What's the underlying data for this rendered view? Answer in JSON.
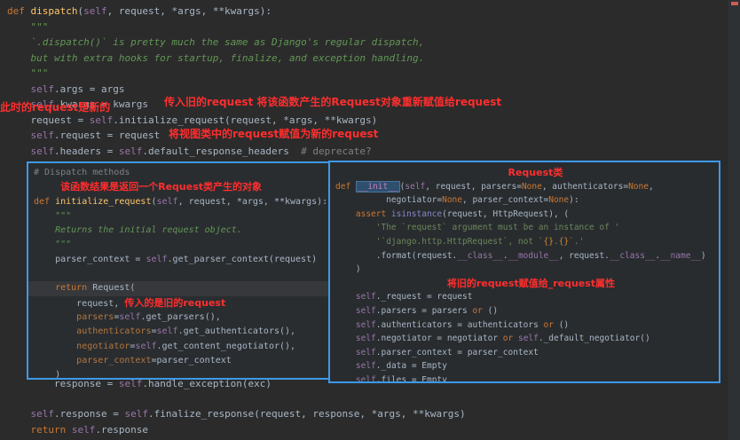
{
  "colors": {
    "bg": "#2b2b2b",
    "fg": "#a9b7c6",
    "kw": "#cc7832",
    "fn": "#ffc66b",
    "slf": "#9876aa",
    "doc": "#629755",
    "com": "#808080",
    "str": "#6a8759",
    "kwa": "#b3773e",
    "bi": "#8888c6",
    "dn": "#9876aa",
    "fmt": "#d0882f",
    "init": "#c77dbb",
    "ann": "#ff2e2e",
    "border": "#3d99e8"
  },
  "annotations": {
    "a1": "此时的request是新的",
    "a2": "传入旧的request 将该函数产生的Request对象重新赋值给request",
    "a3": "将视图类中的request赋值为新的request"
  },
  "code": {
    "top": [
      {
        "s": [
          [
            "kw",
            "def "
          ],
          [
            "fn",
            "dispatch"
          ],
          [
            "fg",
            "("
          ],
          [
            "slf",
            "self"
          ],
          [
            "fg",
            ", request, *args, **kwargs):"
          ]
        ]
      },
      {
        "s": [
          [
            "doc",
            "    \"\"\""
          ]
        ]
      },
      {
        "s": [
          [
            "doc",
            "    `.dispatch()` is pretty much the same as Django's regular dispatch,"
          ]
        ]
      },
      {
        "s": [
          [
            "doc",
            "    but with extra hooks for startup, finalize, and exception handling."
          ]
        ]
      },
      {
        "s": [
          [
            "doc",
            "    \"\"\""
          ]
        ]
      },
      {
        "s": [
          [
            "fg",
            "    "
          ],
          [
            "slf",
            "self"
          ],
          [
            "fg",
            ".args = args"
          ]
        ]
      },
      {
        "s": [
          [
            "fg",
            "    "
          ],
          [
            "slf",
            "self"
          ],
          [
            "fg",
            ".kwargs = kwargs"
          ]
        ]
      },
      {
        "s": [
          [
            "fg",
            "    request = "
          ],
          [
            "slf",
            "self"
          ],
          [
            "fg",
            ".initialize_request(request, *args, **kwargs)"
          ]
        ]
      },
      {
        "s": [
          [
            "fg",
            "    "
          ],
          [
            "slf",
            "self"
          ],
          [
            "fg",
            ".request = request"
          ]
        ]
      },
      {
        "s": [
          [
            "fg",
            "    "
          ],
          [
            "slf",
            "self"
          ],
          [
            "fg",
            ".headers = "
          ],
          [
            "slf",
            "self"
          ],
          [
            "fg",
            ".default_response_headers  "
          ],
          [
            "com",
            "# deprecate?"
          ]
        ]
      }
    ],
    "hidden": [
      {
        "s": [
          [
            "fg",
            "        response = "
          ],
          [
            "slf",
            "self"
          ],
          [
            "fg",
            ".handle_exception(exc)"
          ]
        ]
      }
    ],
    "bottom": [
      {
        "s": [
          [
            "fg",
            "    "
          ],
          [
            "slf",
            "self"
          ],
          [
            "fg",
            ".response = "
          ],
          [
            "slf",
            "self"
          ],
          [
            "fg",
            ".finalize_response(request, response, *args, **kwargs)"
          ]
        ]
      },
      {
        "s": [
          [
            "kw",
            "    return "
          ],
          [
            "slf",
            "self"
          ],
          [
            "fg",
            ".response"
          ]
        ]
      }
    ],
    "left_box": [
      {
        "s": [
          [
            "com",
            "# Dispatch methods"
          ]
        ]
      },
      {
        "s": [
          [
            "fg",
            "     "
          ],
          [
            "ann",
            "该函数结果是返回一个Request类产生的对象"
          ]
        ]
      },
      {
        "s": [
          [
            "kw",
            "def "
          ],
          [
            "fn",
            "initialize_request"
          ],
          [
            "fg",
            "("
          ],
          [
            "slf",
            "self"
          ],
          [
            "fg",
            ", request, *args, **kwargs):"
          ]
        ]
      },
      {
        "s": [
          [
            "doc",
            "    \"\"\""
          ]
        ]
      },
      {
        "s": [
          [
            "doc",
            "    Returns the initial request object."
          ]
        ]
      },
      {
        "s": [
          [
            "doc",
            "    \"\"\""
          ]
        ]
      },
      {
        "s": [
          [
            "fg",
            "    parser_context = "
          ],
          [
            "slf",
            "self"
          ],
          [
            "fg",
            ".get_parser_context(request)"
          ]
        ]
      },
      {
        "s": [
          [
            "fg",
            ""
          ]
        ]
      },
      {
        "hl": true,
        "s": [
          [
            "kw",
            "    return "
          ],
          [
            "fg",
            "Request("
          ]
        ]
      },
      {
        "s": [
          [
            "fg",
            "        request, "
          ],
          [
            "ann",
            "传入的是旧的request"
          ]
        ]
      },
      {
        "s": [
          [
            "fg",
            "        "
          ],
          [
            "kwa",
            "parsers"
          ],
          [
            "fg",
            "="
          ],
          [
            "slf",
            "self"
          ],
          [
            "fg",
            ".get_parsers(),"
          ]
        ]
      },
      {
        "s": [
          [
            "fg",
            "        "
          ],
          [
            "kwa",
            "authenticators"
          ],
          [
            "fg",
            "="
          ],
          [
            "slf",
            "self"
          ],
          [
            "fg",
            ".get_authenticators(),"
          ]
        ]
      },
      {
        "s": [
          [
            "fg",
            "        "
          ],
          [
            "kwa",
            "negotiator"
          ],
          [
            "fg",
            "="
          ],
          [
            "slf",
            "self"
          ],
          [
            "fg",
            ".get_content_negotiator(),"
          ]
        ]
      },
      {
        "s": [
          [
            "fg",
            "        "
          ],
          [
            "kwa",
            "parser_context"
          ],
          [
            "fg",
            "=parser_context"
          ]
        ]
      },
      {
        "s": [
          [
            "fg",
            "    )"
          ]
        ]
      }
    ],
    "right_box": [
      {
        "s": [
          [
            "fg",
            "                                  "
          ],
          [
            "ann",
            "Request类"
          ]
        ]
      },
      {
        "s": [
          [
            "kw",
            "def "
          ],
          [
            "init",
            "__init__"
          ],
          [
            "fg",
            "("
          ],
          [
            "slf",
            "self"
          ],
          [
            "fg",
            ", request, parsers="
          ],
          [
            "kw",
            "None"
          ],
          [
            "fg",
            ", authenticators="
          ],
          [
            "kw",
            "None"
          ],
          [
            "fg",
            ","
          ]
        ]
      },
      {
        "s": [
          [
            "fg",
            "          negotiator="
          ],
          [
            "kw",
            "None"
          ],
          [
            "fg",
            ", parser_context="
          ],
          [
            "kw",
            "None"
          ],
          [
            "fg",
            "):"
          ]
        ]
      },
      {
        "s": [
          [
            "kw",
            "    assert "
          ],
          [
            "bi",
            "isinstance"
          ],
          [
            "fg",
            "(request, HttpRequest), ("
          ]
        ]
      },
      {
        "s": [
          [
            "str",
            "        'The `request` argument must be an instance of '"
          ]
        ]
      },
      {
        "s": [
          [
            "str",
            "        '`django.http.HttpRequest`, not `"
          ],
          [
            "fmt",
            "{}"
          ],
          [
            "str",
            "."
          ],
          [
            "fmt",
            "{}"
          ],
          [
            "str",
            "`.'"
          ]
        ]
      },
      {
        "s": [
          [
            "fg",
            "        .format(request."
          ],
          [
            "dn",
            "__class__"
          ],
          [
            "fg",
            "."
          ],
          [
            "dn",
            "__module__"
          ],
          [
            "fg",
            ", request."
          ],
          [
            "dn",
            "__class__"
          ],
          [
            "fg",
            "."
          ],
          [
            "dn",
            "__name__"
          ],
          [
            "fg",
            ")"
          ]
        ]
      },
      {
        "s": [
          [
            "fg",
            "    )"
          ]
        ]
      },
      {
        "s": [
          [
            "fg",
            "                      "
          ],
          [
            "ann",
            "将旧的request赋值给_request属性"
          ]
        ]
      },
      {
        "s": [
          [
            "fg",
            "    "
          ],
          [
            "slf",
            "self"
          ],
          [
            "fg",
            "._request = request"
          ]
        ]
      },
      {
        "s": [
          [
            "fg",
            "    "
          ],
          [
            "slf",
            "self"
          ],
          [
            "fg",
            ".parsers = parsers "
          ],
          [
            "kw",
            "or"
          ],
          [
            "fg",
            " ()"
          ]
        ]
      },
      {
        "s": [
          [
            "fg",
            "    "
          ],
          [
            "slf",
            "self"
          ],
          [
            "fg",
            ".authenticators = authenticators "
          ],
          [
            "kw",
            "or"
          ],
          [
            "fg",
            " ()"
          ]
        ]
      },
      {
        "s": [
          [
            "fg",
            "    "
          ],
          [
            "slf",
            "self"
          ],
          [
            "fg",
            ".negotiator = negotiator "
          ],
          [
            "kw",
            "or"
          ],
          [
            "fg",
            " "
          ],
          [
            "slf",
            "self"
          ],
          [
            "fg",
            "._default_negotiator()"
          ]
        ]
      },
      {
        "s": [
          [
            "fg",
            "    "
          ],
          [
            "slf",
            "self"
          ],
          [
            "fg",
            ".parser_context = parser_context"
          ]
        ]
      },
      {
        "s": [
          [
            "fg",
            "    "
          ],
          [
            "slf",
            "self"
          ],
          [
            "fg",
            "._data = Empty"
          ]
        ]
      },
      {
        "s": [
          [
            "fg",
            "    "
          ],
          [
            "slf",
            "self"
          ],
          [
            "fg",
            ".files = Empty"
          ]
        ]
      }
    ]
  }
}
